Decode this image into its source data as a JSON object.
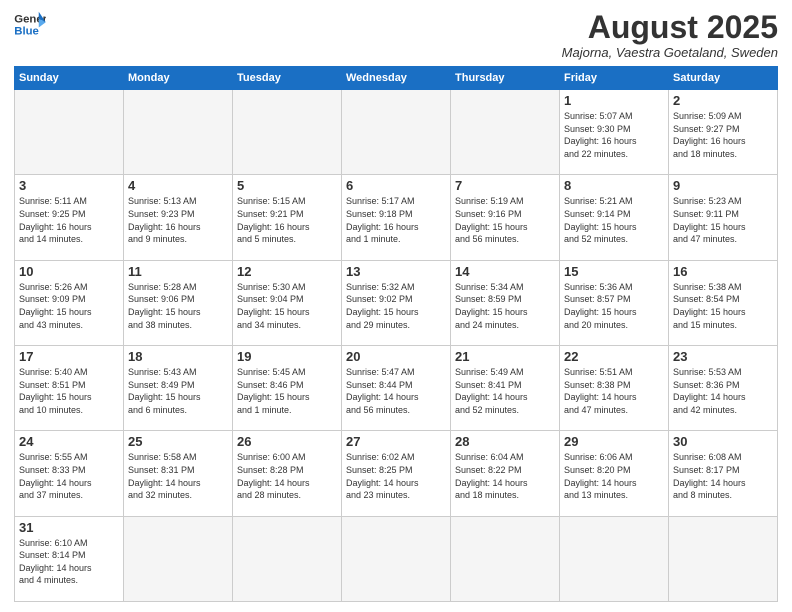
{
  "header": {
    "logo_general": "General",
    "logo_blue": "Blue",
    "month_year": "August 2025",
    "location": "Majorna, Vaestra Goetaland, Sweden"
  },
  "weekdays": [
    "Sunday",
    "Monday",
    "Tuesday",
    "Wednesday",
    "Thursday",
    "Friday",
    "Saturday"
  ],
  "weeks": [
    [
      {
        "day": "",
        "info": ""
      },
      {
        "day": "",
        "info": ""
      },
      {
        "day": "",
        "info": ""
      },
      {
        "day": "",
        "info": ""
      },
      {
        "day": "",
        "info": ""
      },
      {
        "day": "1",
        "info": "Sunrise: 5:07 AM\nSunset: 9:30 PM\nDaylight: 16 hours\nand 22 minutes."
      },
      {
        "day": "2",
        "info": "Sunrise: 5:09 AM\nSunset: 9:27 PM\nDaylight: 16 hours\nand 18 minutes."
      }
    ],
    [
      {
        "day": "3",
        "info": "Sunrise: 5:11 AM\nSunset: 9:25 PM\nDaylight: 16 hours\nand 14 minutes."
      },
      {
        "day": "4",
        "info": "Sunrise: 5:13 AM\nSunset: 9:23 PM\nDaylight: 16 hours\nand 9 minutes."
      },
      {
        "day": "5",
        "info": "Sunrise: 5:15 AM\nSunset: 9:21 PM\nDaylight: 16 hours\nand 5 minutes."
      },
      {
        "day": "6",
        "info": "Sunrise: 5:17 AM\nSunset: 9:18 PM\nDaylight: 16 hours\nand 1 minute."
      },
      {
        "day": "7",
        "info": "Sunrise: 5:19 AM\nSunset: 9:16 PM\nDaylight: 15 hours\nand 56 minutes."
      },
      {
        "day": "8",
        "info": "Sunrise: 5:21 AM\nSunset: 9:14 PM\nDaylight: 15 hours\nand 52 minutes."
      },
      {
        "day": "9",
        "info": "Sunrise: 5:23 AM\nSunset: 9:11 PM\nDaylight: 15 hours\nand 47 minutes."
      }
    ],
    [
      {
        "day": "10",
        "info": "Sunrise: 5:26 AM\nSunset: 9:09 PM\nDaylight: 15 hours\nand 43 minutes."
      },
      {
        "day": "11",
        "info": "Sunrise: 5:28 AM\nSunset: 9:06 PM\nDaylight: 15 hours\nand 38 minutes."
      },
      {
        "day": "12",
        "info": "Sunrise: 5:30 AM\nSunset: 9:04 PM\nDaylight: 15 hours\nand 34 minutes."
      },
      {
        "day": "13",
        "info": "Sunrise: 5:32 AM\nSunset: 9:02 PM\nDaylight: 15 hours\nand 29 minutes."
      },
      {
        "day": "14",
        "info": "Sunrise: 5:34 AM\nSunset: 8:59 PM\nDaylight: 15 hours\nand 24 minutes."
      },
      {
        "day": "15",
        "info": "Sunrise: 5:36 AM\nSunset: 8:57 PM\nDaylight: 15 hours\nand 20 minutes."
      },
      {
        "day": "16",
        "info": "Sunrise: 5:38 AM\nSunset: 8:54 PM\nDaylight: 15 hours\nand 15 minutes."
      }
    ],
    [
      {
        "day": "17",
        "info": "Sunrise: 5:40 AM\nSunset: 8:51 PM\nDaylight: 15 hours\nand 10 minutes."
      },
      {
        "day": "18",
        "info": "Sunrise: 5:43 AM\nSunset: 8:49 PM\nDaylight: 15 hours\nand 6 minutes."
      },
      {
        "day": "19",
        "info": "Sunrise: 5:45 AM\nSunset: 8:46 PM\nDaylight: 15 hours\nand 1 minute."
      },
      {
        "day": "20",
        "info": "Sunrise: 5:47 AM\nSunset: 8:44 PM\nDaylight: 14 hours\nand 56 minutes."
      },
      {
        "day": "21",
        "info": "Sunrise: 5:49 AM\nSunset: 8:41 PM\nDaylight: 14 hours\nand 52 minutes."
      },
      {
        "day": "22",
        "info": "Sunrise: 5:51 AM\nSunset: 8:38 PM\nDaylight: 14 hours\nand 47 minutes."
      },
      {
        "day": "23",
        "info": "Sunrise: 5:53 AM\nSunset: 8:36 PM\nDaylight: 14 hours\nand 42 minutes."
      }
    ],
    [
      {
        "day": "24",
        "info": "Sunrise: 5:55 AM\nSunset: 8:33 PM\nDaylight: 14 hours\nand 37 minutes."
      },
      {
        "day": "25",
        "info": "Sunrise: 5:58 AM\nSunset: 8:31 PM\nDaylight: 14 hours\nand 32 minutes."
      },
      {
        "day": "26",
        "info": "Sunrise: 6:00 AM\nSunset: 8:28 PM\nDaylight: 14 hours\nand 28 minutes."
      },
      {
        "day": "27",
        "info": "Sunrise: 6:02 AM\nSunset: 8:25 PM\nDaylight: 14 hours\nand 23 minutes."
      },
      {
        "day": "28",
        "info": "Sunrise: 6:04 AM\nSunset: 8:22 PM\nDaylight: 14 hours\nand 18 minutes."
      },
      {
        "day": "29",
        "info": "Sunrise: 6:06 AM\nSunset: 8:20 PM\nDaylight: 14 hours\nand 13 minutes."
      },
      {
        "day": "30",
        "info": "Sunrise: 6:08 AM\nSunset: 8:17 PM\nDaylight: 14 hours\nand 8 minutes."
      }
    ],
    [
      {
        "day": "31",
        "info": "Sunrise: 6:10 AM\nSunset: 8:14 PM\nDaylight: 14 hours\nand 4 minutes."
      },
      {
        "day": "",
        "info": ""
      },
      {
        "day": "",
        "info": ""
      },
      {
        "day": "",
        "info": ""
      },
      {
        "day": "",
        "info": ""
      },
      {
        "day": "",
        "info": ""
      },
      {
        "day": "",
        "info": ""
      }
    ]
  ]
}
